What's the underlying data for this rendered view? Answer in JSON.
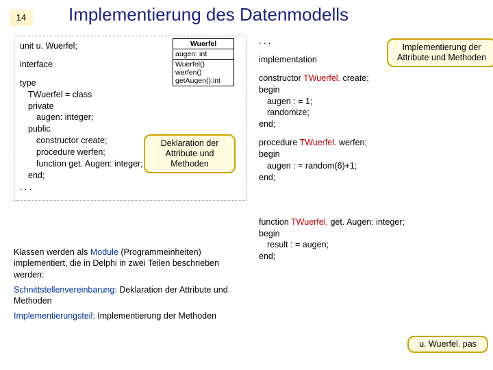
{
  "page": {
    "number": "14",
    "title": "Implementierung des Datenmodells"
  },
  "uml": {
    "classname": "Wuerfel",
    "attr": "augen: int",
    "m1": "Wuerfel()",
    "m2": "werfen()",
    "m3": "getAugen():int"
  },
  "left": {
    "l1": "unit u. Wuerfel;",
    "l2": "interface",
    "l3": "type",
    "l4": "TWuerfel = class",
    "l5": "private",
    "l6": "augen: integer;",
    "l7": "public",
    "l8": "constructor create;",
    "l9": "procedure werfen;",
    "l10": "function get. Augen: integer;",
    "l11": "end;",
    "l12": ". . ."
  },
  "right": {
    "r0": ". . .",
    "r1": "implementation",
    "c1a": "constructor ",
    "c1b": "TWuerfel.",
    "c1c": " create;",
    "c2": "begin",
    "c3": "augen : = 1;",
    "c4": "randomize;",
    "c5": "end;",
    "p1a": "procedure ",
    "p1b": "TWuerfel.",
    "p1c": " werfen;",
    "p2": "begin",
    "p3": "augen : = random(6)+1;",
    "p4": "end;",
    "f1a": "function ",
    "f1b": "TWuerfel.",
    "f1c": " get. Augen: integer;",
    "f2": "begin",
    "f3": "result : = augen;",
    "f4": "end;"
  },
  "callouts": {
    "decl": "Deklaration der Attribute und Methoden",
    "impl": "Implementierung der Attribute und Methoden",
    "file": "u. Wuerfel. pas"
  },
  "bottom": {
    "p1a": "Klassen werden als ",
    "p1b": "Module",
    "p1c": " (Programmeinheiten) implementiert, die in Delphi in zwei Teilen beschrieben werden:",
    "p2a": "Schnittstellenvereinbarung:",
    "p2b": " Deklaration der Attribute und Methoden",
    "p3a": "Implementierungsteil:",
    "p3b": " Implementierung der Methoden"
  }
}
